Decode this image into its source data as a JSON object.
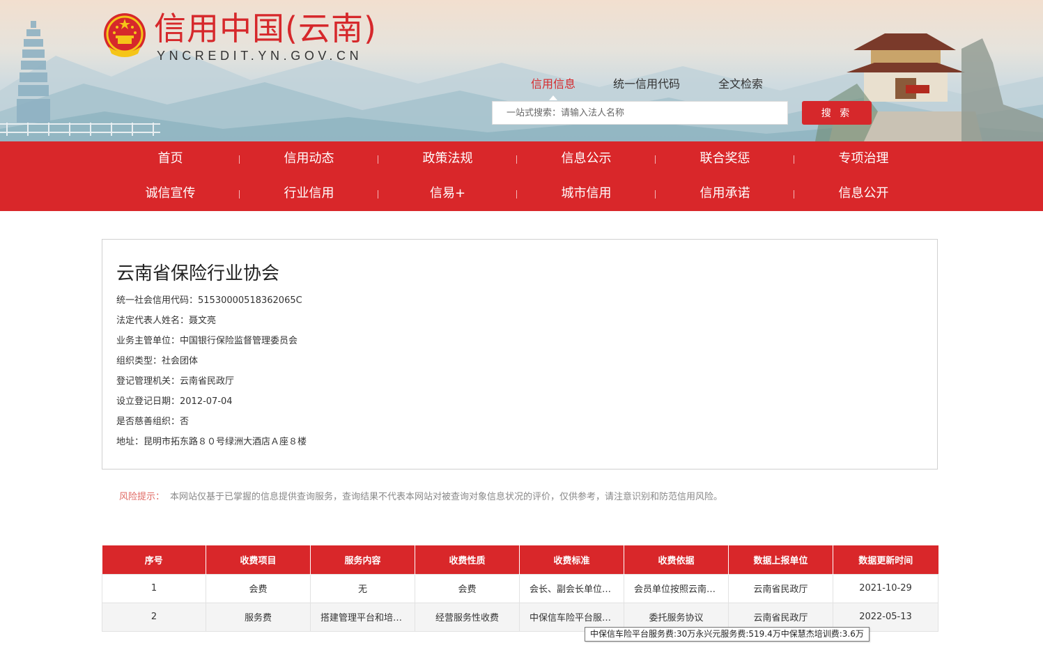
{
  "header": {
    "site_title": "信用中国(云南)",
    "site_domain": "YNCREDIT.YN.GOV.CN",
    "brand_color": "#d6282b"
  },
  "search": {
    "tabs": [
      {
        "label": "信用信息",
        "active": true
      },
      {
        "label": "统一信用代码",
        "active": false
      },
      {
        "label": "全文检索",
        "active": false
      }
    ],
    "placeholder": "一站式搜索：请输入法人名称",
    "button_label": "搜 索"
  },
  "nav": {
    "row1": [
      "首页",
      "信用动态",
      "政策法规",
      "信息公示",
      "联合奖惩",
      "专项治理"
    ],
    "row2": [
      "诚信宣传",
      "行业信用",
      "信易+",
      "城市信用",
      "信用承诺",
      "信息公开"
    ]
  },
  "org": {
    "name": "云南省保险行业协会",
    "fields": [
      {
        "label": "统一社会信用代码：",
        "value": "51530000518362065C"
      },
      {
        "label": "法定代表人姓名：",
        "value": "聂文亮"
      },
      {
        "label": "业务主管单位：",
        "value": "中国银行保险监督管理委员会"
      },
      {
        "label": "组织类型：",
        "value": "社会团体"
      },
      {
        "label": "登记管理机关：",
        "value": "云南省民政厅"
      },
      {
        "label": "设立登记日期：",
        "value": "2012-07-04"
      },
      {
        "label": "是否慈善组织：",
        "value": "否"
      },
      {
        "label": "地址：",
        "value": "昆明市拓东路８０号绿洲大酒店Ａ座８楼"
      }
    ]
  },
  "risk": {
    "label": "风险提示：",
    "text": "本网站仅基于已掌握的信息提供查询服务，查询结果不代表本网站对被查询对象信息状况的评价，仅供参考，请注意识别和防范信用风险。"
  },
  "fee_table": {
    "columns": [
      "序号",
      "收费项目",
      "服务内容",
      "收费性质",
      "收费标准",
      "收费依据",
      "数据上报单位",
      "数据更新时间"
    ],
    "rows": [
      [
        "1",
        "会费",
        "无",
        "会费",
        "会长、副会长单位每年交纳会费…",
        "会员单位按照云南省保险行业协会章程…",
        "云南省民政厅",
        "2021-10-29"
      ],
      [
        "2",
        "服务费",
        "搭建管理平台和培训服务…",
        "经营服务性收费",
        "中保信车险平台服务费…",
        "委托服务协议",
        "云南省民政厅",
        "2022-05-13"
      ]
    ]
  },
  "tooltip": {
    "text": "中保信车险平台服务费:30万永兴元服务费:519.4万中保慧杰培训费:3.6万"
  }
}
